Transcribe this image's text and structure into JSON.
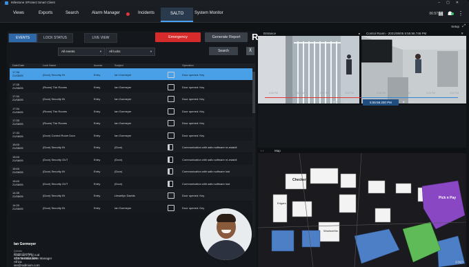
{
  "window": {
    "title": "Milestone XProtect Smart Client"
  },
  "menu": {
    "items": [
      "Views",
      "Exports",
      "Search",
      "Alarm Manager",
      "Incidents",
      "SALTO",
      "System Monitor"
    ],
    "clock": "06:57:16",
    "setup": "Setup"
  },
  "panel": {
    "tabs": [
      "EVENTS",
      "LOCK STATUS",
      "LIVE VIEW"
    ],
    "emergency": "Emergency",
    "generate_report": "Generate Report",
    "filter_events": "All events",
    "filter_locks": "All locks",
    "search": "Search"
  },
  "table": {
    "columns": [
      "Date/Date",
      "Lock Name",
      "Access",
      "Subject",
      "",
      "Operation"
    ],
    "rows": [
      {
        "time": "17:36",
        "date": "21/08/05",
        "lock": "(Door) Security IN",
        "access": "Entry",
        "subject": "Ian Gormeyer",
        "op": "Door opened: Key",
        "icon": "card",
        "selected": true
      },
      {
        "time": "17:35",
        "date": "21/08/05",
        "lock": "(Room) The Rooms",
        "access": "Entry",
        "subject": "Ian Gormeyer",
        "op": "Door opened: Key",
        "icon": "card"
      },
      {
        "time": "17:34",
        "date": "21/08/05",
        "lock": "(Door) Security IN",
        "access": "Entry",
        "subject": "Ian Gormeyer",
        "op": "Door opened: Key",
        "icon": "card"
      },
      {
        "time": "17:34",
        "date": "21/08/05",
        "lock": "(Room) The Rooms",
        "access": "Entry",
        "subject": "Ian Gormeyer",
        "op": "Door opened: Key",
        "icon": "card"
      },
      {
        "time": "17:33",
        "date": "21/08/05",
        "lock": "(Room) The Rooms",
        "access": "Entry",
        "subject": "Ian Gormeyer",
        "op": "Door opened: Key",
        "icon": "card"
      },
      {
        "time": "17:33",
        "date": "21/08/05",
        "lock": "(Door) Control Room Door",
        "access": "Entry",
        "subject": "Ian Gormeyer",
        "op": "Door opened: Key",
        "icon": "card"
      },
      {
        "time": "15:03",
        "date": "21/08/05",
        "lock": "(Door) Security IN",
        "access": "Entry",
        "subject": "(Door)",
        "op": "Communication with salto software re-establi",
        "icon": "door"
      },
      {
        "time": "15:03",
        "date": "21/08/05",
        "lock": "(Door) Security OUT",
        "access": "Entry",
        "subject": "(Door)",
        "op": "Communication with salto software re-establi",
        "icon": "door"
      },
      {
        "time": "15:00",
        "date": "21/08/05",
        "lock": "(Door) Security IN",
        "access": "Entry",
        "subject": "(Door)",
        "op": "Communication with salto software lost",
        "icon": "door"
      },
      {
        "time": "15:00",
        "date": "21/08/05",
        "lock": "(Door) Security OUT",
        "access": "Entry",
        "subject": "(Door)",
        "op": "Communication with salto software lost",
        "icon": "door"
      },
      {
        "time": "14:35",
        "date": "21/08/05",
        "lock": "(Door) Security IN",
        "access": "Entry",
        "subject": "Llewellyn Davids",
        "op": "Door opened: Key",
        "icon": "card"
      },
      {
        "time": "14:33",
        "date": "21/08/05",
        "lock": "(Door) Security IN",
        "access": "Entry",
        "subject": "Ian Gormeyer",
        "op": "Door opened: Key",
        "icon": "card"
      }
    ]
  },
  "details": {
    "name": "Ian Gormeyer",
    "phone_label": "Phone Number",
    "phone": "+27 78 8003 339",
    "details_label": "Details",
    "company": "Radinium (Pty) Ltd",
    "role": "Channel Business Manager",
    "region": "Africa",
    "email": "ian@radinium.com"
  },
  "video": {
    "cam1": "Entrance",
    "cam2": "Control Room - 2021/08/05 5:55:58.748 PM",
    "timestamp": "5:55:58.200 PM",
    "ticks": [
      "5:48 PM",
      "5:50 PM",
      "5:52 PM",
      "5:53 PM",
      "5:56 PM",
      "5:58 PM",
      "6:00 PM",
      "6:02 PM"
    ]
  },
  "map": {
    "title": "Map",
    "labels": [
      "Checkers",
      "Edgars",
      "Pick n Pay",
      "Woolworths"
    ],
    "find": "FIND"
  },
  "colors": {
    "accent": "#2f68a8",
    "emergency": "#d62b2b",
    "selected_row": "#4aa0e6"
  }
}
